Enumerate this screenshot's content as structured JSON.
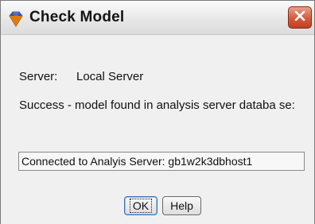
{
  "window": {
    "title": "Check Model",
    "icon": "gem-icon",
    "close_icon": "close-icon",
    "accent": "#d35b3e"
  },
  "server": {
    "label": "Server:",
    "value": "Local Server"
  },
  "message": "Success - model found in analysis server databa se:",
  "status_field": {
    "value": "Connected to Analyis Server: gb1w2k3dbhost1"
  },
  "buttons": {
    "ok_label": "OK",
    "help_label": "Help"
  }
}
